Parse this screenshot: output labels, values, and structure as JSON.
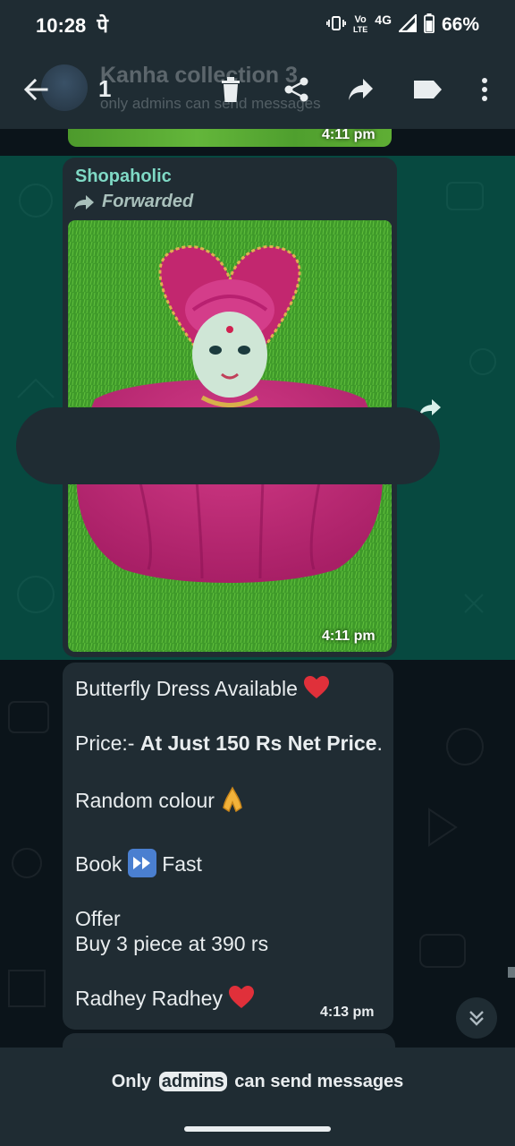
{
  "status_bar": {
    "time": "10:28",
    "time_suffix": "पे",
    "network_top": "Vo",
    "network_bottom": "LTE",
    "network_type": "4G",
    "battery_percent": "66%"
  },
  "app_bar": {
    "group_name": "Kanha collection 3",
    "group_subtitle": "only admins can send messages",
    "selected_count": "1"
  },
  "chat": {
    "prev_message_time": "4:11 pm",
    "image_message": {
      "sender": "Shopaholic",
      "forwarded_label": "Forwarded",
      "time": "4:11 pm"
    },
    "text_message": {
      "line1": "Butterfly Dress Available",
      "price_prefix": "Price:-",
      "price_bold": "At Just 150 Rs Net Price",
      "price_suffix": ".",
      "line3": "Random colour",
      "line4_before": "Book",
      "line4_after": "Fast",
      "line5": "Offer",
      "line6": "Buy 3   piece at 390 rs",
      "line7": "Radhey Radhey",
      "time": "4:13 pm"
    }
  },
  "footer": {
    "text_before": "Only",
    "text_link": "admins",
    "text_after": "can send messages"
  },
  "colors": {
    "app_bar": "#1f2c33",
    "chat_bg": "#0b141a",
    "bubble": "#202c33",
    "selection_highlight": "#00a884",
    "sender_name": "#7fd9c5"
  },
  "icons": [
    "back-arrow-icon",
    "trash-icon",
    "share-icon",
    "forward-icon",
    "label-icon",
    "more-vert-icon",
    "forward-share-icon",
    "scroll-down-icon",
    "heart-emoji",
    "folded-hands-emoji",
    "fast-forward-emoji"
  ]
}
